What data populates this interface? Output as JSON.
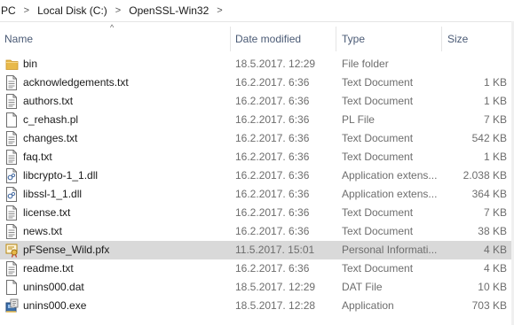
{
  "breadcrumb": [
    "PC",
    "Local Disk (C:)",
    "OpenSSL-Win32"
  ],
  "columns": {
    "name": "Name",
    "date": "Date modified",
    "type": "Type",
    "size": "Size"
  },
  "files": [
    {
      "name": "bin",
      "date": "18.5.2017. 12:29",
      "type": "File folder",
      "size": "",
      "icon": "folder-icon"
    },
    {
      "name": "acknowledgements.txt",
      "date": "16.2.2017. 6:36",
      "type": "Text Document",
      "size": "1 KB",
      "icon": "text-document-icon"
    },
    {
      "name": "authors.txt",
      "date": "16.2.2017. 6:36",
      "type": "Text Document",
      "size": "1 KB",
      "icon": "text-document-icon"
    },
    {
      "name": "c_rehash.pl",
      "date": "16.2.2017. 6:36",
      "type": "PL File",
      "size": "7 KB",
      "icon": "blank-file-icon"
    },
    {
      "name": "changes.txt",
      "date": "16.2.2017. 6:36",
      "type": "Text Document",
      "size": "542 KB",
      "icon": "text-document-icon"
    },
    {
      "name": "faq.txt",
      "date": "16.2.2017. 6:36",
      "type": "Text Document",
      "size": "1 KB",
      "icon": "text-document-icon"
    },
    {
      "name": "libcrypto-1_1.dll",
      "date": "16.2.2017. 6:36",
      "type": "Application extens...",
      "size": "2.038 KB",
      "icon": "dll-file-icon"
    },
    {
      "name": "libssl-1_1.dll",
      "date": "16.2.2017. 6:36",
      "type": "Application extens...",
      "size": "364 KB",
      "icon": "dll-file-icon"
    },
    {
      "name": "license.txt",
      "date": "16.2.2017. 6:36",
      "type": "Text Document",
      "size": "7 KB",
      "icon": "text-document-icon"
    },
    {
      "name": "news.txt",
      "date": "16.2.2017. 6:36",
      "type": "Text Document",
      "size": "38 KB",
      "icon": "text-document-icon"
    },
    {
      "name": "pFSense_Wild.pfx",
      "date": "11.5.2017. 15:01",
      "type": "Personal Informati...",
      "size": "4 KB",
      "icon": "certificate-icon",
      "selected": true
    },
    {
      "name": "readme.txt",
      "date": "16.2.2017. 6:36",
      "type": "Text Document",
      "size": "4 KB",
      "icon": "text-document-icon"
    },
    {
      "name": "unins000.dat",
      "date": "18.5.2017. 12:29",
      "type": "DAT File",
      "size": "10 KB",
      "icon": "blank-file-icon"
    },
    {
      "name": "unins000.exe",
      "date": "18.5.2017. 12:28",
      "type": "Application",
      "size": "703 KB",
      "icon": "installer-icon"
    }
  ],
  "colors": {
    "selected_row": "#d9d9d9",
    "folder": "#e8b94a",
    "header_text": "#4a5a75"
  }
}
